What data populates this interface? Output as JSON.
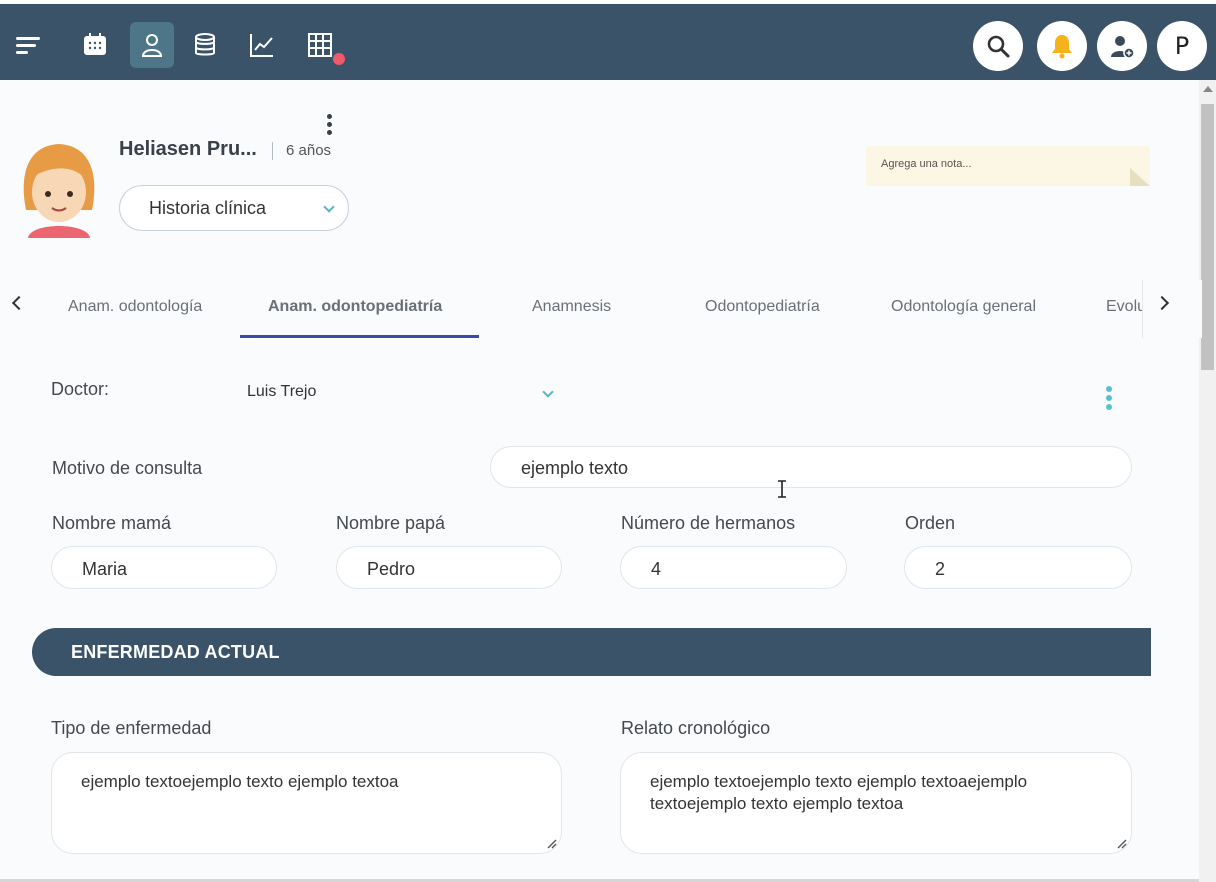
{
  "nav": {
    "icons": [
      "menu-icon",
      "calendar-icon",
      "patient-icon",
      "database-icon",
      "chart-line-icon",
      "table-grid-icon"
    ],
    "right_icons": [
      "search-icon",
      "bell-icon",
      "add-user-icon"
    ],
    "profile_initial": "P",
    "colors": {
      "bar": "#3a5368",
      "active": "#4d7689",
      "bell": "#f5b21b",
      "badge": "#f05a6a"
    }
  },
  "patient": {
    "name": "Heliasen Pru...",
    "age": "6 años",
    "record_select": "Historia clínica",
    "note_placeholder": "Agrega una nota..."
  },
  "tabs": [
    {
      "label": "Anam. odontología",
      "active": false
    },
    {
      "label": "Anam. odontopediatría",
      "active": true
    },
    {
      "label": "Anamnesis",
      "active": false
    },
    {
      "label": "Odontopediatría",
      "active": false
    },
    {
      "label": "Odontología general",
      "active": false
    },
    {
      "label": "Evolu",
      "active": false
    }
  ],
  "form": {
    "doctor_label": "Doctor:",
    "doctor_value": "Luis Trejo",
    "motivo_label": "Motivo de consulta",
    "motivo_value": "ejemplo texto",
    "mama_label": "Nombre mamá",
    "mama_value": "Maria",
    "papa_label": "Nombre papá",
    "papa_value": "Pedro",
    "hermanos_label": "Número de hermanos",
    "hermanos_value": "4",
    "orden_label": "Orden",
    "orden_value": "2"
  },
  "section": {
    "title": "ENFERMEDAD ACTUAL",
    "tipo_label": "Tipo de enfermedad",
    "tipo_value": "ejemplo textoejemplo texto ejemplo textoa",
    "relato_label": "Relato cronológico",
    "relato_value": "ejemplo textoejemplo texto ejemplo textoaejemplo textoejemplo texto ejemplo textoa"
  }
}
